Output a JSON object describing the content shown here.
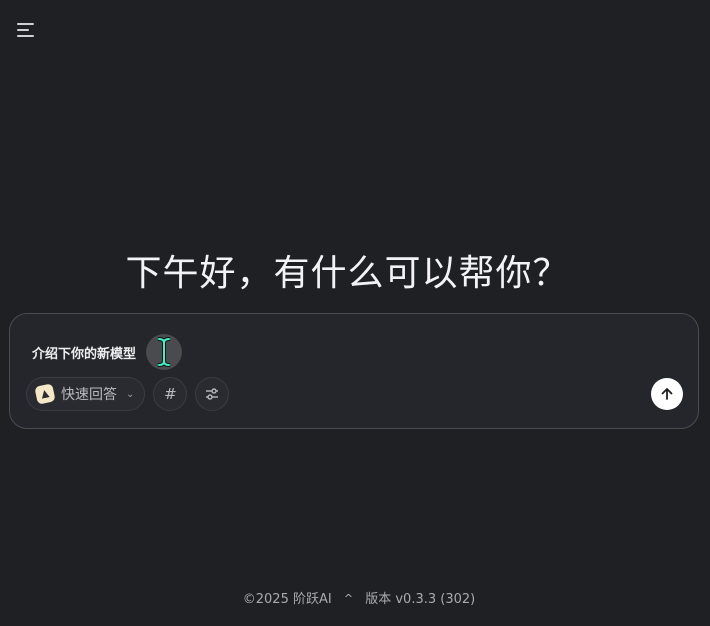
{
  "header": {
    "menu_icon": "menu-icon"
  },
  "greeting": "下午好，有什么可以帮你？",
  "composer": {
    "prompt": "介绍下你的新模型",
    "mode_label": "快速回答",
    "hash_label": "#",
    "settings_icon": "sliders-icon",
    "send_icon": "arrow-up-icon"
  },
  "footer": {
    "copyright": "©2025 阶跃AI",
    "caret": "^",
    "version": "版本 v0.3.3 (302)"
  },
  "colors": {
    "background": "#1f2023",
    "composer_bg": "#25262c",
    "cursor_accent": "#43f0c8"
  }
}
